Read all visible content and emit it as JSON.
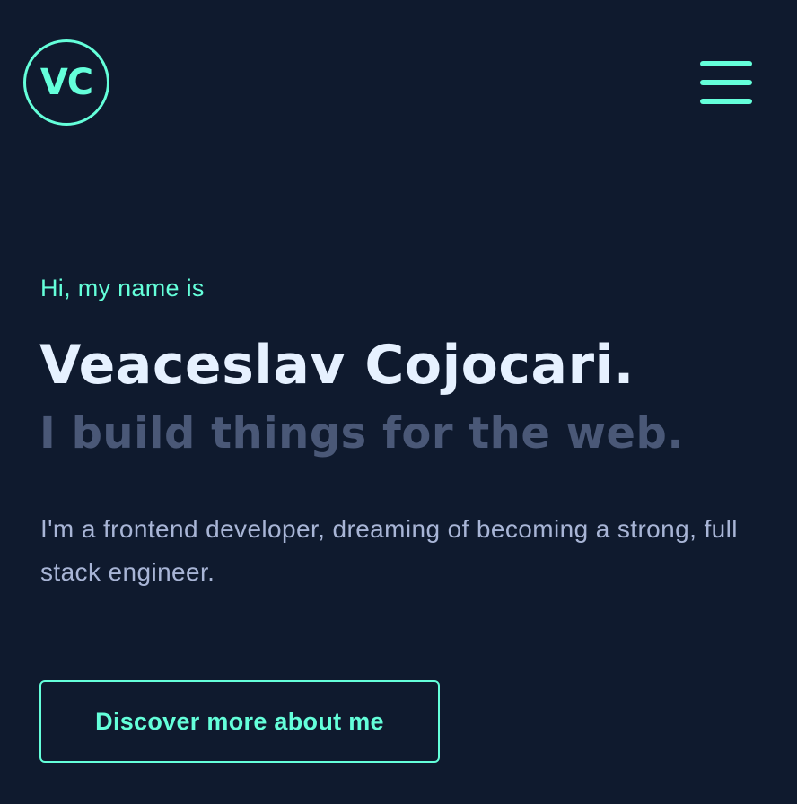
{
  "header": {
    "logo_text": "VC",
    "menu_icon": "hamburger-menu-icon"
  },
  "hero": {
    "greeting": "Hi, my name is",
    "name": "Veaceslav Cojocari.",
    "tagline": "I build things for the web.",
    "description": "I'm a frontend developer, dreaming of becoming a strong, full stack engineer.",
    "cta_label": "Discover more about me"
  },
  "colors": {
    "background": "#0f1a2e",
    "accent": "#64ffda",
    "heading": "#e6f1ff",
    "muted_heading": "#4a5877",
    "body_text": "#a8b5d6"
  }
}
